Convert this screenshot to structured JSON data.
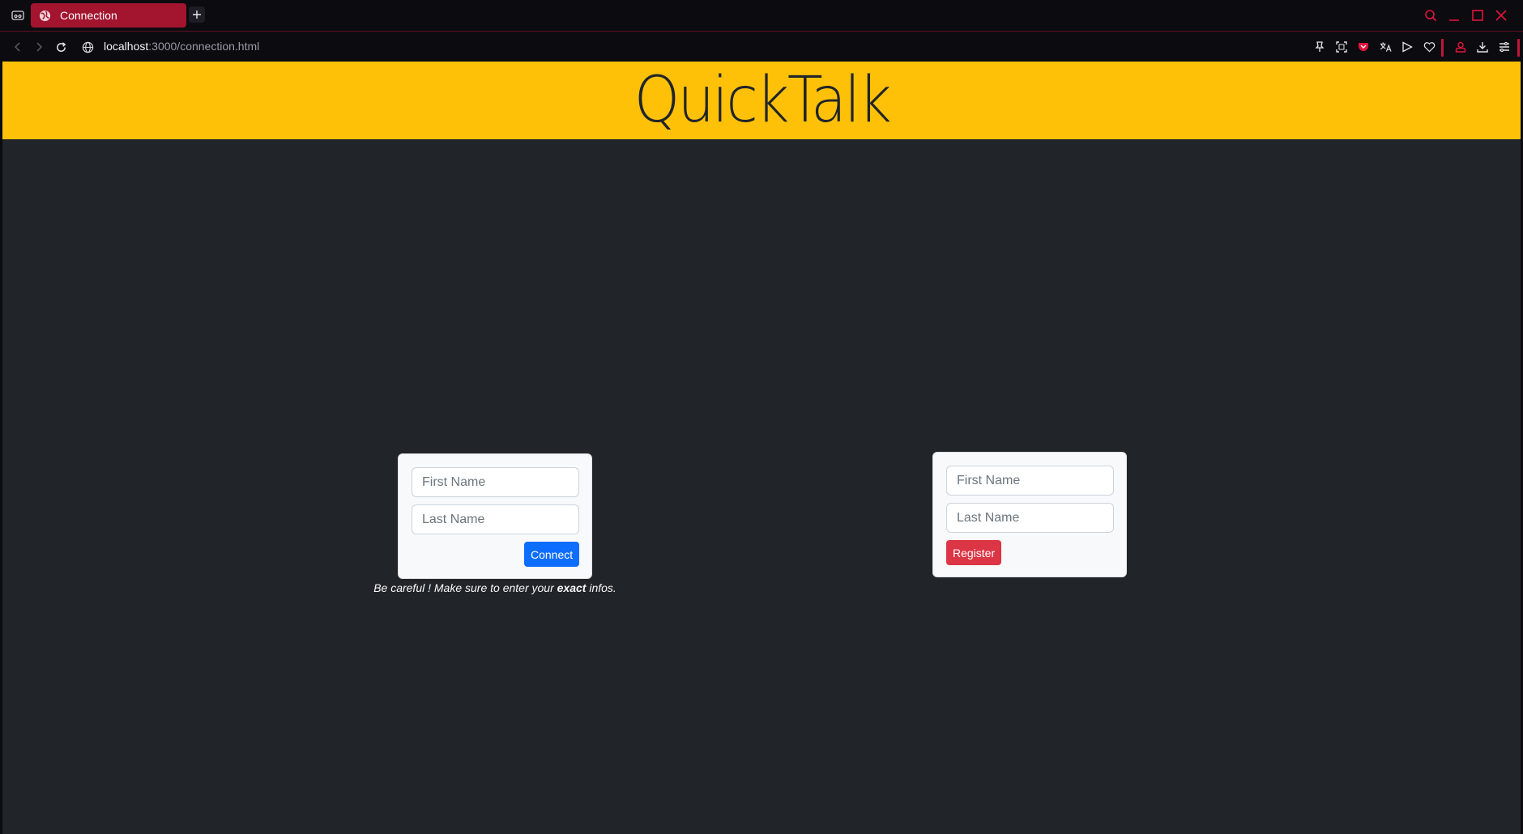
{
  "browser": {
    "tab": {
      "title": "Connection"
    },
    "address": {
      "host": "localhost",
      "rest": ":3000/connection.html"
    },
    "colors": {
      "accent": "#a3142f",
      "chrome": "#0c0b10"
    }
  },
  "page": {
    "header": {
      "title": "QuickTalk",
      "background": "#ffc107"
    },
    "connect_form": {
      "first_name_placeholder": "First Name",
      "last_name_placeholder": "Last Name",
      "submit_label": "Connect"
    },
    "register_form": {
      "first_name_placeholder": "First Name",
      "last_name_placeholder": "Last Name",
      "submit_label": "Register"
    },
    "note": {
      "before": "Be careful ! Make sure to enter your ",
      "emphasis": "exact",
      "after": " infos."
    },
    "colors": {
      "body_bg": "#212529",
      "connect_button": "#0d6efd",
      "register_button": "#dc3545"
    }
  }
}
